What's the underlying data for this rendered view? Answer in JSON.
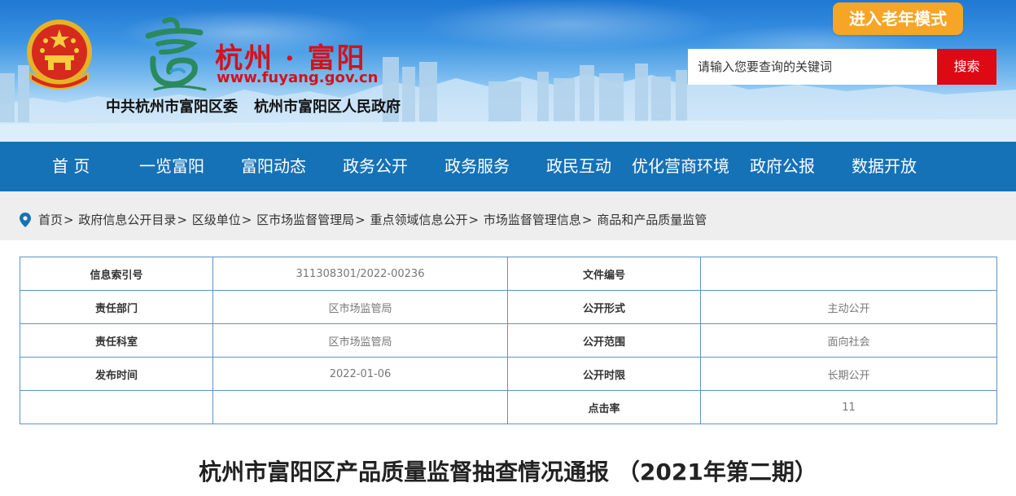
{
  "header": {
    "site_name": "杭州 · 富阳",
    "site_url": "www.fuyang.gov.cn",
    "org_party": "中共杭州市富阳区委",
    "org_gov": "杭州市富阳区人民政府",
    "elder_mode_label": "进入老年模式",
    "search_placeholder": "请输入您要查询的关键词",
    "search_button_label": "搜索",
    "emblem_icon": "national-emblem-icon",
    "logo_icon": "fuyang-logo-icon"
  },
  "nav": {
    "items": [
      {
        "label": "首 页"
      },
      {
        "label": "一览富阳"
      },
      {
        "label": "富阳动态"
      },
      {
        "label": "政务公开"
      },
      {
        "label": "政务服务"
      },
      {
        "label": "政民互动"
      },
      {
        "label": "优化营商环境"
      },
      {
        "label": "政府公报"
      },
      {
        "label": "数据开放"
      }
    ]
  },
  "breadcrumb": {
    "icon": "location-pin-icon",
    "items": [
      {
        "label": "首页"
      },
      {
        "label": "政府信息公开目录"
      },
      {
        "label": "区级单位"
      },
      {
        "label": "区市场监督管理局"
      },
      {
        "label": "重点领域信息公开"
      },
      {
        "label": "市场监督管理信息"
      },
      {
        "label": "商品和产品质量监管"
      }
    ],
    "separator": ">"
  },
  "info": {
    "rows": [
      {
        "label1": "信息索引号",
        "value1": "311308301/2022-00236",
        "label2": "文件编号",
        "value2": ""
      },
      {
        "label1": "责任部门",
        "value1": "区市场监管局",
        "label2": "公开形式",
        "value2": "主动公开"
      },
      {
        "label1": "责任科室",
        "value1": "区市场监管局",
        "label2": "公开范围",
        "value2": "面向社会"
      },
      {
        "label1": "发布时间",
        "value1": "2022-01-06",
        "label2": "公开时限",
        "value2": "长期公开"
      },
      {
        "label1": "",
        "value1": "",
        "label2": "点击率",
        "value2": "11"
      }
    ]
  },
  "article": {
    "title": "杭州市富阳区产品质量监督抽查情况通报 （2021年第二期）"
  },
  "colors": {
    "nav_bg": "#1672b7",
    "accent_red": "#d4121a",
    "search_button": "#dd0a14",
    "elder_button": "#f6a526",
    "table_border": "#5e93c8"
  }
}
